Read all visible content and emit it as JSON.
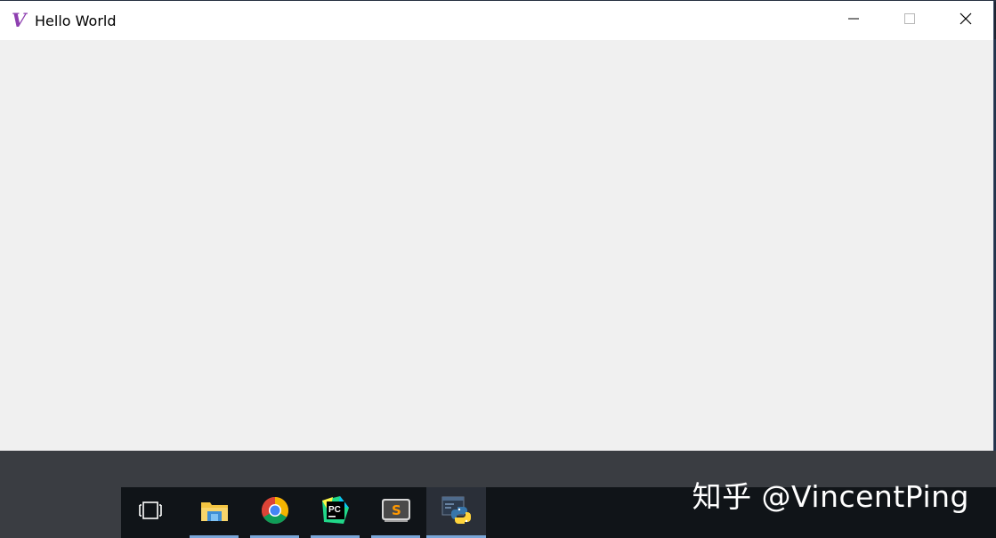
{
  "window": {
    "title": "Hello World",
    "icon": "vim-v-icon",
    "controls": [
      "minimize-icon",
      "maximize-icon",
      "close-icon"
    ]
  },
  "taskbar": {
    "items": [
      {
        "name": "task-view",
        "icon": "task-view-icon"
      },
      {
        "name": "file-explorer",
        "icon": "folder-icon"
      },
      {
        "name": "chrome",
        "icon": "chrome-icon"
      },
      {
        "name": "pycharm",
        "icon": "pycharm-icon"
      },
      {
        "name": "sublime-text",
        "icon": "sublime-icon"
      },
      {
        "name": "python",
        "icon": "python-icon"
      }
    ]
  },
  "watermark": {
    "text": "知乎 @VincentPing"
  },
  "colors": {
    "title_bar": "#ffffff",
    "client_area": "#f0f0f0",
    "taskbar": "#101418",
    "taskbar_underline": "#7aa6d8",
    "vim_purple": "#8e3fb0"
  }
}
